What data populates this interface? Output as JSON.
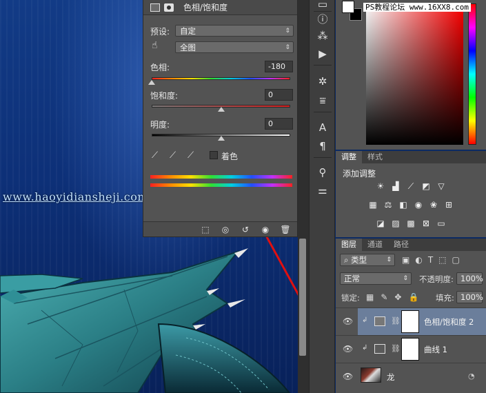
{
  "canvas": {
    "watermark": "www.haoyidiansheji.com"
  },
  "properties": {
    "title": "色相/饱和度",
    "preset_label": "预设:",
    "preset_value": "自定",
    "channel_value": "全图",
    "hue_label": "色相:",
    "hue_value": "-180",
    "saturation_label": "饱和度:",
    "saturation_value": "0",
    "lightness_label": "明度:",
    "lightness_value": "0",
    "colorize_label": "着色",
    "colorize_checked": false,
    "hue_fraction": 0.0,
    "saturation_fraction": 0.5,
    "lightness_fraction": 0.5
  },
  "color_panel": {
    "foreground": "#ffffff",
    "background": "#000000",
    "watermark": "PS教程论坛 www.16XX8.com"
  },
  "adjustments": {
    "tabs": [
      "调整",
      "样式"
    ],
    "active_tab": 0,
    "title": "添加调整"
  },
  "layers": {
    "tabs": [
      "图层",
      "通道",
      "路径"
    ],
    "active_tab": 0,
    "filter_label": "类型",
    "blend_mode": "正常",
    "opacity_label": "不透明度:",
    "opacity_value": "100%",
    "lock_label": "锁定:",
    "fill_label": "填充:",
    "fill_value": "100%",
    "items": [
      {
        "name": "色相/饱和度 2",
        "selected": true
      },
      {
        "name": "曲线 1",
        "selected": false
      },
      {
        "name": "龙",
        "selected": false
      }
    ]
  },
  "annotation": {
    "arrow_color": "#e01010"
  }
}
